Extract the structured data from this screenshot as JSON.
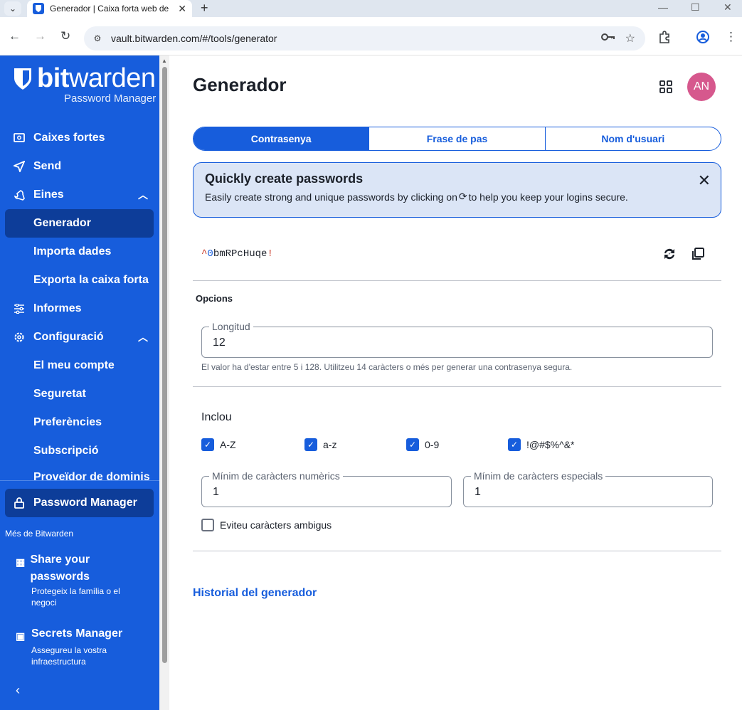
{
  "browser": {
    "tab_title": "Generador | Caixa forta web de",
    "url": "vault.bitwarden.com/#/tools/generator"
  },
  "sidebar": {
    "logo_word_bold": "bit",
    "logo_word_light": "warden",
    "logo_sub": "Password Manager",
    "items": [
      {
        "label": "Caixes fortes",
        "icon": "vault-icon"
      },
      {
        "label": "Send",
        "icon": "send-icon"
      },
      {
        "label": "Eines",
        "icon": "wrench-icon"
      },
      {
        "label": "Generador"
      },
      {
        "label": "Importa dades"
      },
      {
        "label": "Exporta la caixa forta"
      },
      {
        "label": "Informes",
        "icon": "sliders-icon"
      },
      {
        "label": "Configuració",
        "icon": "gear-icon"
      },
      {
        "label": "El meu compte"
      },
      {
        "label": "Seguretat"
      },
      {
        "label": "Preferències"
      },
      {
        "label": "Subscripció"
      },
      {
        "label": "Proveïdor de dominis"
      }
    ],
    "product_switch": "Password Manager",
    "more_label": "Més de Bitwarden",
    "promos": [
      {
        "title": "Share your passwords",
        "desc": "Protegeix la família o el negoci"
      },
      {
        "title": "Secrets Manager",
        "desc": "Assegureu la vostra infraestructura"
      }
    ]
  },
  "main": {
    "title": "Generador",
    "avatar": "AN",
    "tabs": [
      "Contrasenya",
      "Frase de pas",
      "Nom d'usuari"
    ],
    "callout": {
      "heading": "Quickly create passwords",
      "body_before": "Easily create strong and unique passwords by clicking on",
      "body_after": "to help you keep your logins secure."
    },
    "password": {
      "p1": "^",
      "p2": "0",
      "p3": "bmRPcHuqe",
      "p4": "!"
    },
    "options_title": "Opcions",
    "length": {
      "label": "Longitud",
      "value": "12",
      "hint": "El valor ha d'estar entre 5 i 128. Utilitzeu 14 caràcters o més per generar una contrasenya segura."
    },
    "include_label": "Inclou",
    "checkboxes": [
      "A-Z",
      "a-z",
      "0-9",
      "!@#$%^&*"
    ],
    "min_numeric": {
      "label": "Mínim de caràcters numèrics",
      "value": "1"
    },
    "min_special": {
      "label": "Mínim de caràcters especials",
      "value": "1"
    },
    "avoid_ambiguous": "Eviteu caràcters ambigus",
    "history_link": "Historial del generador"
  }
}
